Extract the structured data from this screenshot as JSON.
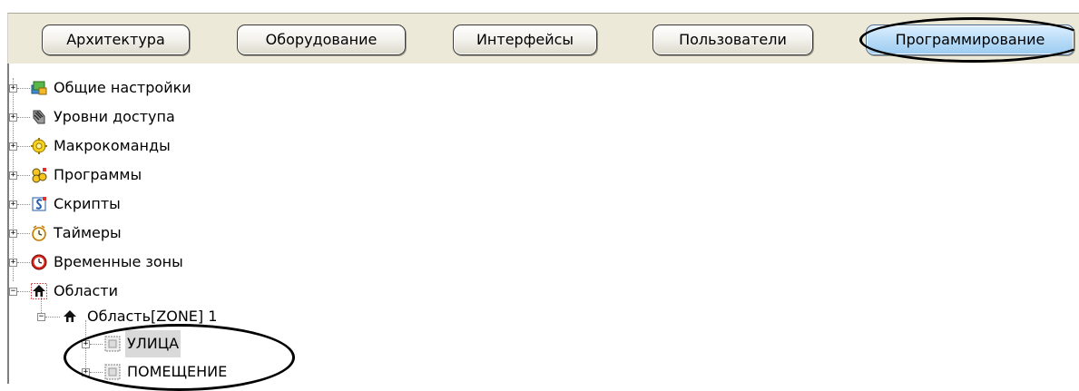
{
  "tabs": [
    {
      "label": "Архитектура",
      "active": false
    },
    {
      "label": "Оборудование",
      "active": false
    },
    {
      "label": "Интерфейсы",
      "active": false
    },
    {
      "label": "Пользователи",
      "active": false
    },
    {
      "label": "Программирование",
      "active": true
    }
  ],
  "tree": [
    {
      "label": "Общие настройки",
      "icon": "general-settings-icon",
      "expander": "+"
    },
    {
      "label": "Уровни доступа",
      "icon": "access-levels-icon",
      "expander": "+"
    },
    {
      "label": "Макрокоманды",
      "icon": "macro-icon",
      "expander": "+"
    },
    {
      "label": "Программы",
      "icon": "programs-icon",
      "expander": "+"
    },
    {
      "label": "Скрипты",
      "icon": "scripts-icon",
      "expander": "+"
    },
    {
      "label": "Таймеры",
      "icon": "timers-icon",
      "expander": "+"
    },
    {
      "label": "Временные зоны",
      "icon": "time-zones-icon",
      "expander": "+"
    },
    {
      "label": "Области",
      "icon": "areas-icon",
      "expander": "−"
    },
    {
      "label": "Область[ZONE] 1",
      "icon": "area-icon",
      "expander": "−"
    },
    {
      "label": "УЛИЦА",
      "icon": "zone-icon",
      "expander": "+"
    },
    {
      "label": "ПОМЕЩЕНИЕ",
      "icon": "zone-icon",
      "expander": "+"
    }
  ],
  "colors": {
    "active_tab": "#b9dcf7",
    "tab_bar": "#ece9d8",
    "selection": "#d9d9d9"
  }
}
